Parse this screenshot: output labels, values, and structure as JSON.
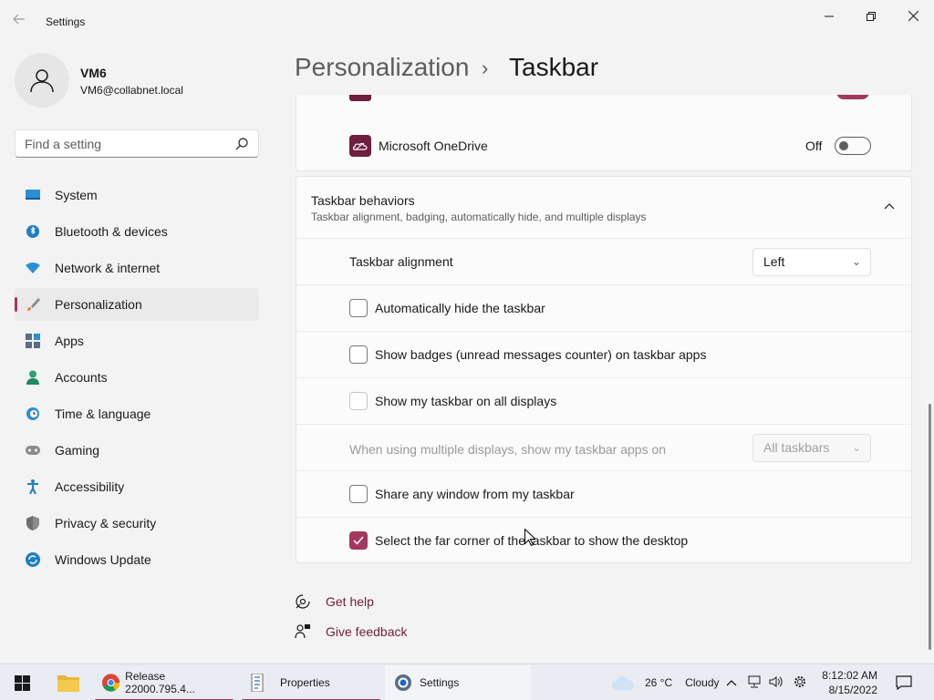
{
  "window": {
    "title": "Settings",
    "controls": [
      "minimize",
      "restore",
      "close"
    ]
  },
  "profile": {
    "name": "VM6",
    "email": "VM6@collabnet.local"
  },
  "search": {
    "placeholder": "Find a setting"
  },
  "nav": {
    "items": [
      {
        "label": "System",
        "icon": "monitor-icon",
        "color": "#1f7fc4"
      },
      {
        "label": "Bluetooth & devices",
        "icon": "bluetooth-icon",
        "color": "#1f7fc4"
      },
      {
        "label": "Network & internet",
        "icon": "wifi-icon",
        "color": "#1f7fc4"
      },
      {
        "label": "Personalization",
        "icon": "brush-icon",
        "color": "#e07b39",
        "active": true
      },
      {
        "label": "Apps",
        "icon": "apps-icon",
        "color": "#5a6b85"
      },
      {
        "label": "Accounts",
        "icon": "accounts-icon",
        "color": "#2aa372"
      },
      {
        "label": "Time & language",
        "icon": "clock-globe-icon",
        "color": "#1f7fc4"
      },
      {
        "label": "Gaming",
        "icon": "gamepad-icon",
        "color": "#707070"
      },
      {
        "label": "Accessibility",
        "icon": "accessibility-icon",
        "color": "#1f7fc4"
      },
      {
        "label": "Privacy & security",
        "icon": "shield-icon",
        "color": "#707070"
      },
      {
        "label": "Windows Update",
        "icon": "update-icon",
        "color": "#1f7fc4"
      }
    ]
  },
  "header": {
    "parent": "Personalization",
    "separator": "›",
    "current": "Taskbar"
  },
  "onedrive": {
    "label": "Microsoft OneDrive",
    "state": "Off"
  },
  "behaviors": {
    "title": "Taskbar behaviors",
    "subtitle": "Taskbar alignment, badging, automatically hide, and multiple displays",
    "alignment_label": "Taskbar alignment",
    "alignment_value": "Left",
    "auto_hide": {
      "label": "Automatically hide the taskbar",
      "checked": false
    },
    "badges": {
      "label": "Show badges (unread messages counter) on taskbar apps",
      "checked": false
    },
    "all_displays": {
      "label": "Show my taskbar on all displays",
      "checked": false,
      "disabled": true
    },
    "multi_display_label": "When using multiple displays, show my taskbar apps on",
    "multi_display_value": "All taskbars",
    "share_window": {
      "label": "Share any window from my taskbar",
      "checked": false
    },
    "far_corner": {
      "label": "Select the far corner of the taskbar to show the desktop",
      "checked": true
    }
  },
  "help": {
    "get_help": "Get help",
    "give_feedback": "Give feedback"
  },
  "taskbar": {
    "apps": [
      {
        "label": "Release 22000.795.4...",
        "icon": "chrome-icon"
      },
      {
        "label": "Properties",
        "icon": "properties-icon"
      },
      {
        "label": "Settings",
        "icon": "settings-gear-icon",
        "active": true
      }
    ],
    "weather": {
      "temp": "26 °C",
      "condition": "Cloudy"
    },
    "time": "8:12:02 AM",
    "date": "8/15/2022"
  },
  "colors": {
    "accent": "#a4375e",
    "link": "#6f1e3f"
  }
}
